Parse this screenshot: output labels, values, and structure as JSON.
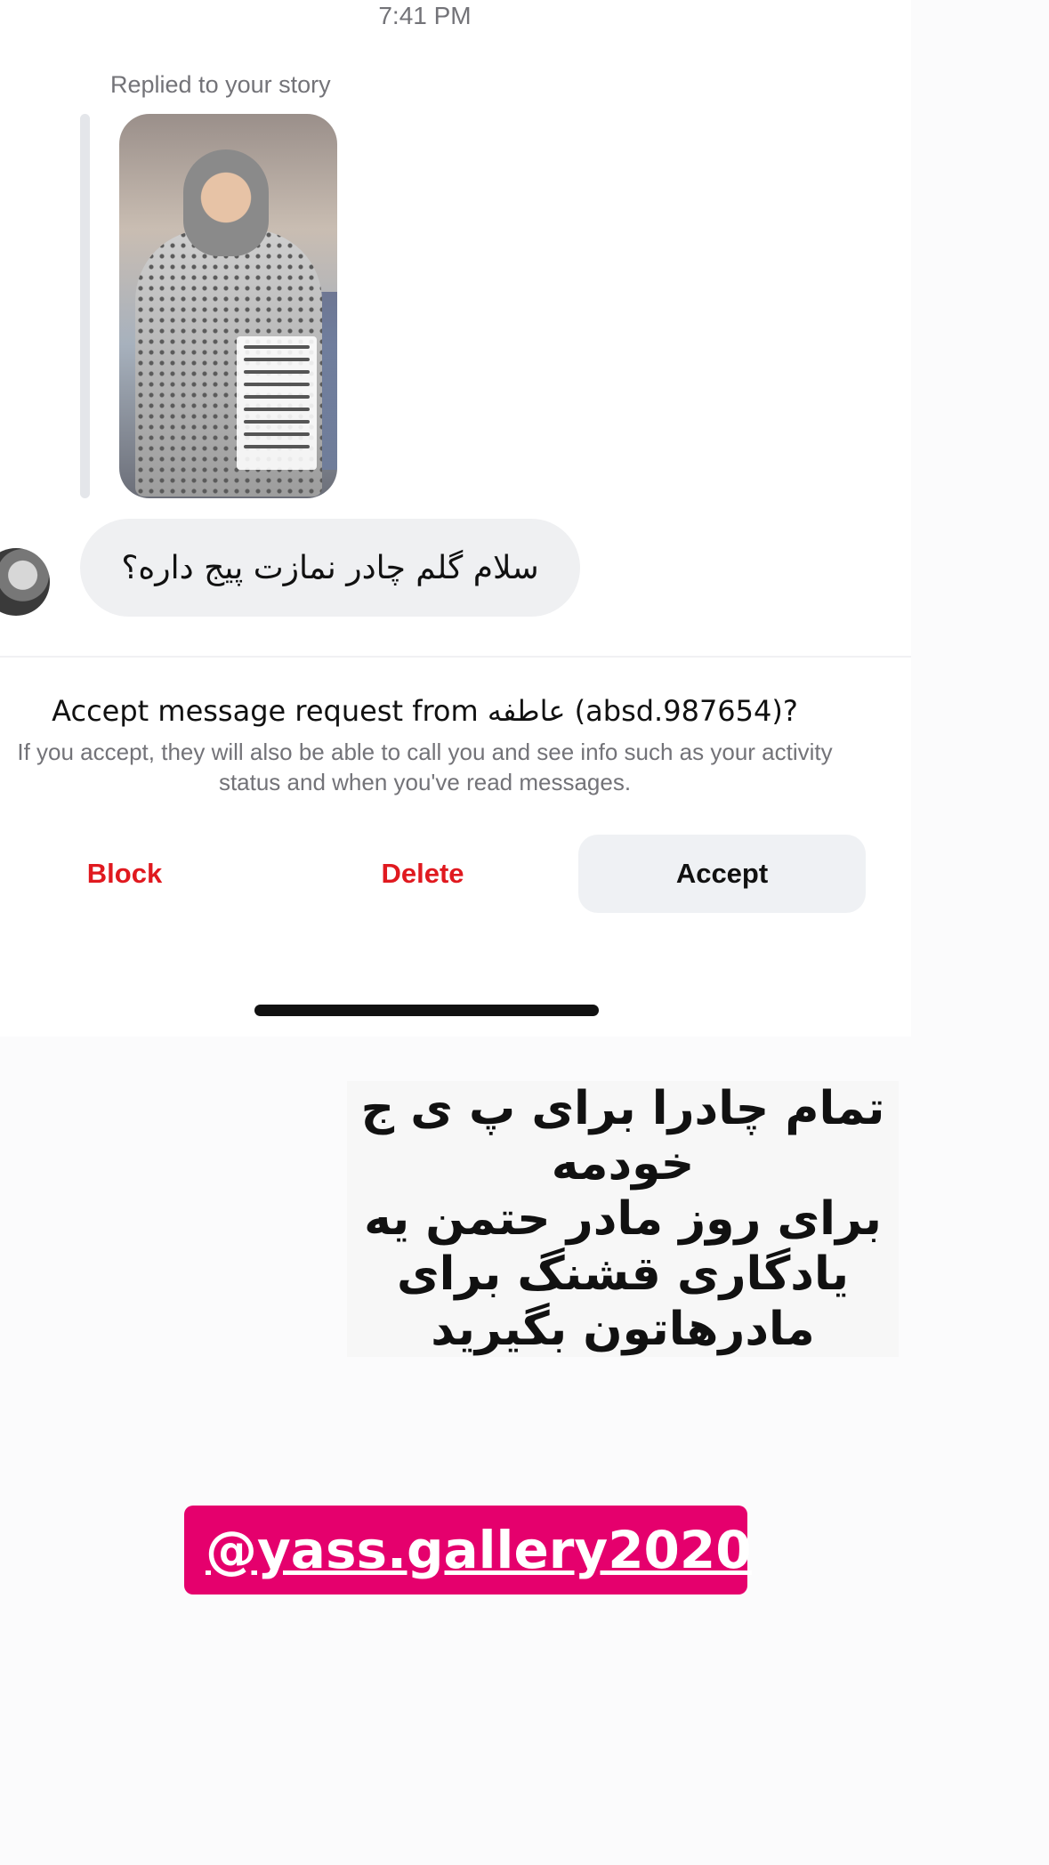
{
  "status": {
    "time": "7:41 PM"
  },
  "thread": {
    "replied_label": "Replied to your story",
    "message": "سلام گلم چادر نمازت پیج داره؟"
  },
  "request": {
    "title": "Accept message request from عاطفه (absd.987654)?",
    "subtitle": "If you accept, they will also be able to call you and see info such as your activity status and when you've read messages.",
    "block_label": "Block",
    "delete_label": "Delete",
    "accept_label": "Accept"
  },
  "overlay": {
    "lines": [
      "تمام چادرا برای پ ی ج",
      "خودمه",
      "برای روز  مادر حتمن یه",
      "یادگاری قشنگ برای",
      "مادرهاتون بگیرید"
    ],
    "mention": "@yass.gallery2020"
  },
  "colors": {
    "danger": "#e0191f",
    "mention_bg": "#e5006d",
    "bubble_bg": "#eff0f2"
  },
  "icons": {
    "avatar": "user-avatar",
    "story": "story-thumbnail"
  }
}
